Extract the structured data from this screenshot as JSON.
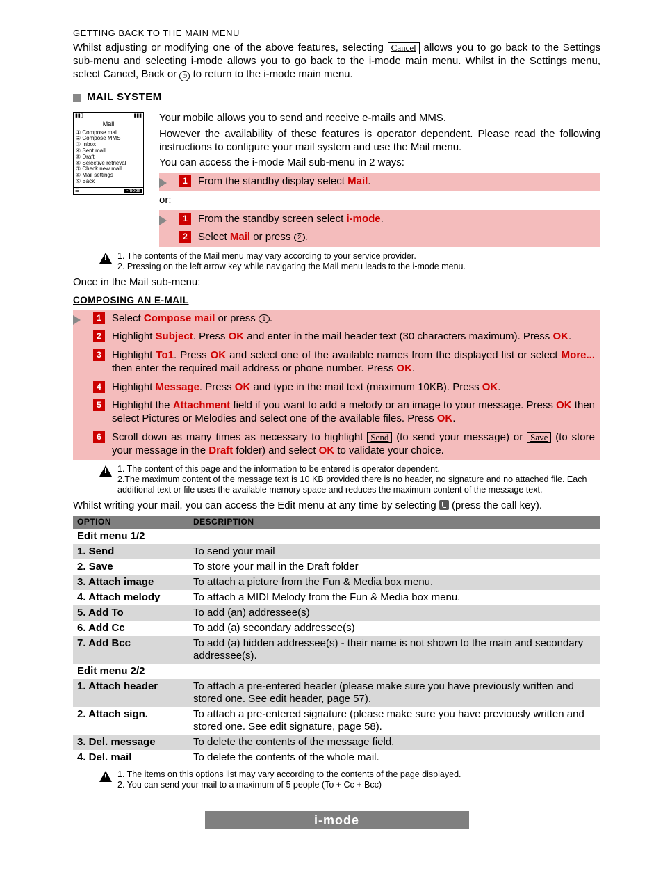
{
  "top": {
    "heading": "GETTING BACK TO THE MAIN MENU",
    "para_a": "Whilst adjusting or modifying one of the above features, selecting ",
    "btn_cancel": "Cancel",
    "para_b": " allows you to go back to the Settings sub-menu and selecting i-mode allows you to go back to the i-mode main menu. Whilst in the Settings menu, select Cancel, Back or ",
    "para_c": " to return to the i-mode main menu."
  },
  "mail": {
    "heading": "MAIL SYSTEM",
    "intro_a": "Your mobile allows you to send and receive e-mails and MMS.",
    "intro_b": "However the availability of these features is operator dependent. Please read the following instructions to configure your mail system and use the Mail menu.",
    "intro_c": "You can access the i-mode Mail sub-menu in 2 ways:",
    "step1_a": "From the standby display select ",
    "step1_b": "Mail",
    "step1_c": ".",
    "or": "or:",
    "step2a_a": "From the standby screen select ",
    "step2a_b": "i-mode",
    "step2a_c": ".",
    "step2b_a": "Select ",
    "step2b_b": "Mail",
    "step2b_c": " or press ",
    "step2b_d": ".",
    "warn1": "1. The contents of the Mail menu may vary according to your service provider.",
    "warn2": "2. Pressing on the left arrow key while navigating the Mail menu leads to the i-mode menu.",
    "once": "Once in the Mail sub-menu:"
  },
  "phone": {
    "title": "Mail",
    "items": [
      "① Compose mail",
      "② Compose MMS",
      "③ Inbox",
      "④ Sent mail",
      "⑤ Draft",
      "⑥ Selective retrieval",
      "⑦ Check new mail",
      "⑧ Mail settings",
      "⑨ Back"
    ],
    "bottom": "i-mode"
  },
  "compose": {
    "heading": "COMPOSING AN E-MAIL",
    "s1_a": "Select ",
    "s1_b": "Compose mail",
    "s1_c": " or press ",
    "s1_d": ".",
    "s2_a": "Highlight ",
    "s2_b": "Subject",
    "s2_c": ". Press ",
    "s2_d": "OK",
    "s2_e": " and enter in the mail header text (30 characters maximum). Press ",
    "s2_f": "OK",
    "s2_g": ".",
    "s3_a": "Highlight ",
    "s3_b": "To1",
    "s3_c": ". Press ",
    "s3_d": "OK",
    "s3_e": " and select one of the available names from the displayed list or select ",
    "s3_f": "More...",
    "s3_g": " then enter the required mail address or phone number. Press ",
    "s3_h": "OK",
    "s3_i": ".",
    "s4_a": "Highlight ",
    "s4_b": "Message",
    "s4_c": ". Press ",
    "s4_d": "OK",
    "s4_e": " and type in the mail text (maximum 10KB). Press ",
    "s4_f": "OK",
    "s4_g": ".",
    "s5_a": "Highlight the ",
    "s5_b": "Attachment",
    "s5_c": " field if you want to add a melody or an image to your message. Press ",
    "s5_d": "OK",
    "s5_e": " then select Pictures or Melodies and select one of the available files. Press ",
    "s5_f": "OK",
    "s5_g": ".",
    "s6_a": "Scroll down as many times as necessary to highlight ",
    "s6_send": "Send",
    "s6_b": " (to send your message) or ",
    "s6_save": "Save",
    "s6_c": " (to store your message in the ",
    "s6_draft": "Draft",
    "s6_d": " folder) and select ",
    "s6_ok": "OK",
    "s6_e": " to validate your choice.",
    "warn1": "1. The content of this page and the information to be entered is operator dependent.",
    "warn2": "2.The maximum content of the message text is 10 KB provided there is no header, no signature and no attached file. Each additional text or file uses the available memory space and reduces the maximum content of the message text.",
    "edit_intro_a": "Whilst writing your mail, you can access the Edit menu at any time by selecting ",
    "edit_intro_b": " (press the call key)."
  },
  "table": {
    "h1": "OPTION",
    "h2": "DESCRIPTION",
    "rows": [
      {
        "opt": "Edit menu 1/2",
        "desc": "",
        "shade": false
      },
      {
        "opt": "1. Send",
        "desc": "To send your mail",
        "shade": true
      },
      {
        "opt": "2. Save",
        "desc": "To store your mail in the Draft folder",
        "shade": false
      },
      {
        "opt": "3. Attach image",
        "desc": "To attach a picture from the Fun & Media box menu.",
        "shade": true
      },
      {
        "opt": "4. Attach melody",
        "desc": "To attach a MIDI Melody from the Fun & Media box menu.",
        "shade": false
      },
      {
        "opt": "5. Add To",
        "desc": "To add (an) addressee(s)",
        "shade": true
      },
      {
        "opt": "6. Add Cc",
        "desc": "To add (a) secondary addressee(s)",
        "shade": false
      },
      {
        "opt": "7. Add Bcc",
        "desc": "To add (a) hidden addressee(s) - their name is not shown to the main and secondary addressee(s).",
        "shade": true
      },
      {
        "opt": "Edit menu 2/2",
        "desc": "",
        "shade": false
      },
      {
        "opt": "1. Attach header",
        "desc": "To attach a pre-entered header (please make sure you have previously written and stored one. See edit header, page 57).",
        "shade": true
      },
      {
        "opt": "2. Attach sign.",
        "desc": "To attach a pre-entered signature (please make sure you have previously written and stored one. See edit signature, page 58).",
        "shade": false
      },
      {
        "opt": "3. Del. message",
        "desc": "To delete the contents of the message field.",
        "shade": true
      },
      {
        "opt": "4. Del. mail",
        "desc": "To delete the contents of the whole mail.",
        "shade": false
      }
    ],
    "warn1": "1. The items on this options list may vary according to the contents of the page displayed.",
    "warn2": "2. You can send your mail to a maximum of 5 people (To + Cc + Bcc)"
  },
  "footer": "i-mode"
}
